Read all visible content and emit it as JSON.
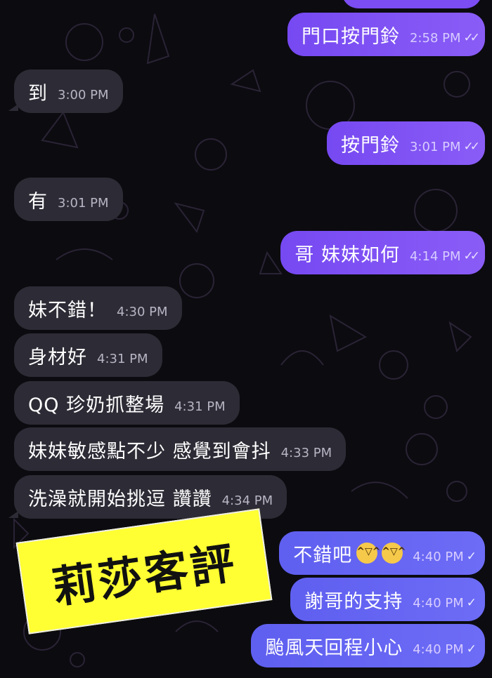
{
  "messages": [
    {
      "text": "門口按門鈴",
      "time": "2:58 PM",
      "status": "✓✓"
    },
    {
      "text": "到",
      "time": "3:00 PM"
    },
    {
      "text": "按門鈴",
      "time": "3:01 PM",
      "status": "✓✓"
    },
    {
      "text": "有",
      "time": "3:01 PM"
    },
    {
      "text": "哥 妹妹如何",
      "time": "4:14 PM",
      "status": "✓✓"
    },
    {
      "text": "妹不錯！",
      "time": "4:30 PM"
    },
    {
      "text": "身材好",
      "time": "4:31 PM"
    },
    {
      "text": "QQ 珍奶抓整場",
      "time": "4:31 PM"
    },
    {
      "text": "妹妹敏感點不少 感覺到會抖",
      "time": "4:33 PM"
    },
    {
      "text": "洗澡就開始挑逗 讚讚",
      "time": "4:34 PM"
    },
    {
      "text": "不錯吧",
      "time": "4:40 PM",
      "status": "✓",
      "emoji": [
        "laughing-crying",
        "laughing-crying"
      ]
    },
    {
      "text": "謝哥的支持",
      "time": "4:40 PM",
      "status": "✓"
    },
    {
      "text": "颱風天回程小心",
      "time": "4:40 PM",
      "status": "✓"
    }
  ],
  "sticker": {
    "text": "莉莎客評"
  },
  "colors": {
    "background": "#0c0b10",
    "incoming_bubble": "#2d2b35",
    "outgoing_bubble": "#7b4df3",
    "outgoing_bubble_blue": "#6362f2",
    "sticker": "#ffff33"
  }
}
